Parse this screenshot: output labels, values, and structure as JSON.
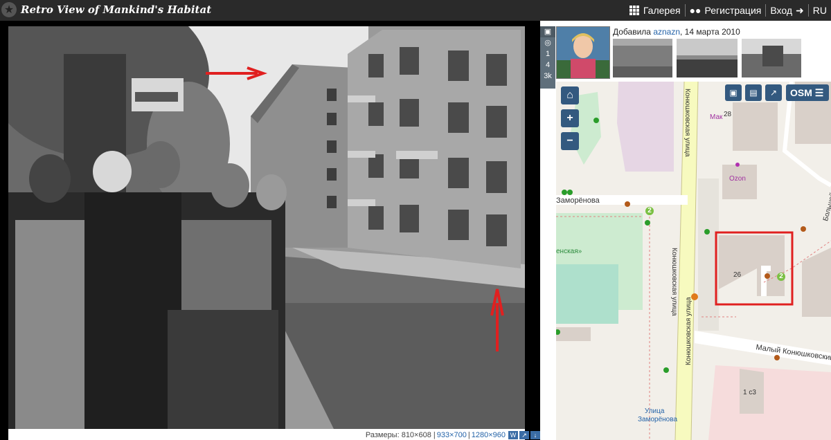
{
  "header": {
    "site_title": "Retro View of Mankind's Habitat",
    "nav": [
      {
        "label": "Галерея",
        "icon": "grid-icon"
      },
      {
        "label": "Регистрация",
        "icon": "users-icon"
      },
      {
        "label": "Вход",
        "icon": "login-icon"
      },
      {
        "label": "RU",
        "icon": ""
      }
    ]
  },
  "photo_tools": {
    "views": "1",
    "today": "4",
    "total": "3k"
  },
  "photo_info": {
    "added_prefix": "Добавила",
    "user": "aznazn",
    "date": ", 14 марта 2010"
  },
  "dimensions": {
    "label": "Размеры: 810×608 |",
    "link1": "933×700",
    "link2": "1280×960"
  },
  "map": {
    "osm_label": "OSM",
    "labels": {
      "street_konyushkovskaya_top": "Конюшковская улица",
      "street_konyushkovskaya_bottom": "Конюшковская улица",
      "zamorenova": "Заморёнова",
      "maly_konyushkovsky": "Малый Конюшковский",
      "bolshoy_konyushkovsky": "Большой Конюшковский пер.",
      "mak": "Мак",
      "ozon": "Ozon",
      "n28": "28",
      "n26": "26",
      "n1c3": "1 с3",
      "presnenskaya": "енская»",
      "ulitsa": "Улица",
      "zamorenova_station": "Заморёнова",
      "badge2a": "2",
      "badge2b": "2"
    }
  }
}
